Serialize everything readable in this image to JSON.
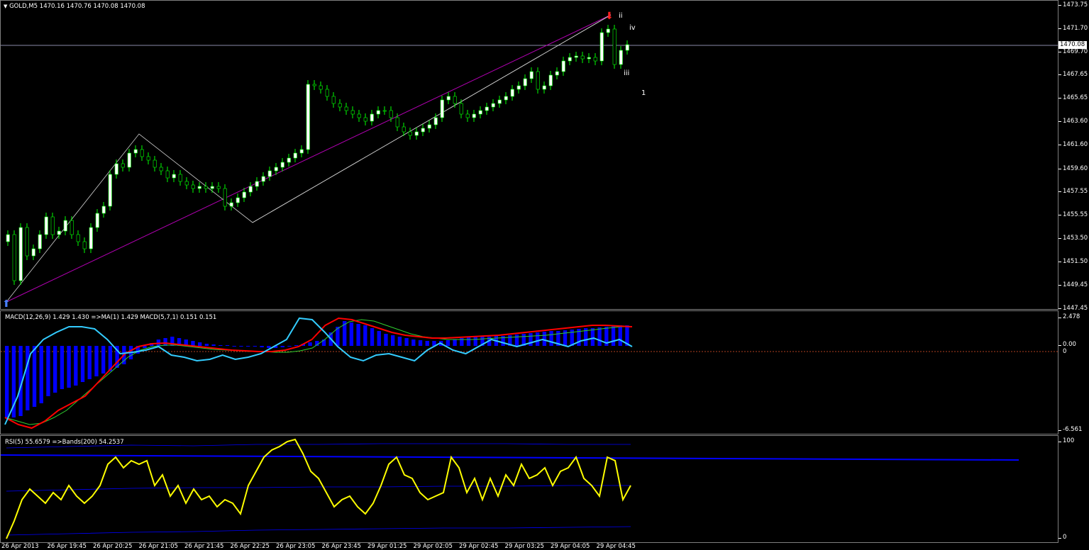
{
  "main": {
    "title": "GOLD,M5  1470.16 1470.76 1470.08 1470.08",
    "current_price": "1470.08",
    "y_ticks": [
      "1473.75",
      "1471.70",
      "1469.70",
      "1467.65",
      "1465.65",
      "1463.60",
      "1461.60",
      "1459.60",
      "1457.55",
      "1455.55",
      "1453.50",
      "1451.50",
      "1449.45",
      "1447.45"
    ],
    "wave_labels": [
      {
        "text": "ii",
        "color": "#ff2020"
      },
      {
        "text": "iv",
        "color": "#ff2020"
      },
      {
        "text": "iii",
        "color": "#ff2020"
      },
      {
        "text": "1",
        "color": "#ff8000"
      }
    ]
  },
  "macd": {
    "title": "MACD(12,26,9) 1.429 1.430  =>MA(1) 1.429  MACD(5,7,1) 0.151 0.151",
    "y_ticks": [
      "2.478",
      "0.00",
      "0",
      "-6.561"
    ]
  },
  "rsi": {
    "title": "RSI(5) 55.6579  =>Bands(200) 54.2537",
    "y_ticks": [
      "100",
      "0"
    ]
  },
  "time_axis": [
    "26 Apr 2013",
    "26 Apr 19:45",
    "26 Apr 20:25",
    "26 Apr 21:05",
    "26 Apr 21:45",
    "26 Apr 22:25",
    "26 Apr 23:05",
    "26 Apr 23:45",
    "29 Apr 01:25",
    "29 Apr 02:05",
    "29 Apr 02:45",
    "29 Apr 03:25",
    "29 Apr 04:05",
    "29 Apr 04:45"
  ],
  "colors": {
    "bull_candle": "#ffffff",
    "bear_candle": "#000000",
    "wick": "#00ff00",
    "trendline": "#b000b0",
    "macd_hist": "#0000ff",
    "macd_signal": "#ff0000",
    "macd_line": "#33ccff",
    "rsi_line": "#ffff00",
    "rsi_band": "#0000ff"
  }
}
